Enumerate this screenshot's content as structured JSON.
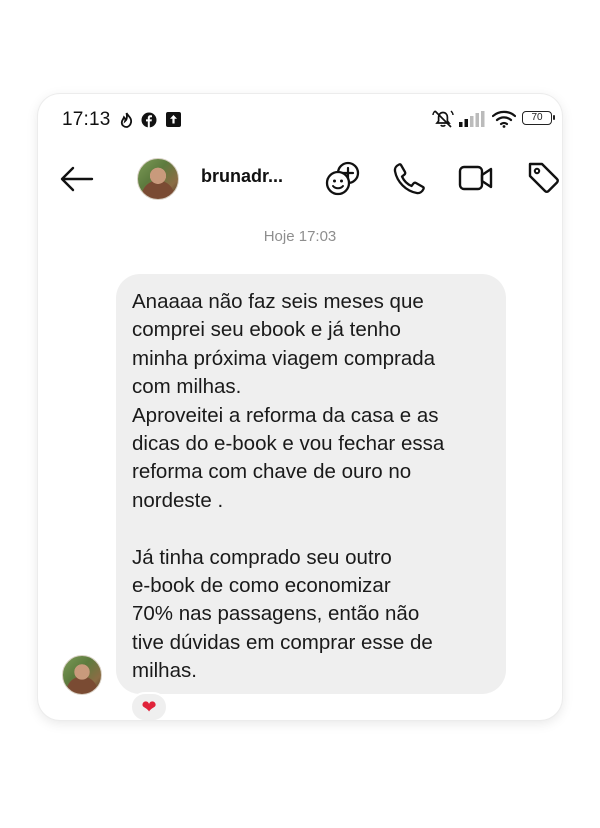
{
  "status_bar": {
    "time": "17:13",
    "battery": "70",
    "icons": [
      "flame-icon",
      "facebook-icon",
      "upload-icon",
      "mute-icon",
      "signal-icon",
      "wifi-icon",
      "battery-icon"
    ]
  },
  "header": {
    "username": "brunadr...",
    "icons": [
      "back-arrow-icon",
      "avatar",
      "effects-icon",
      "phone-icon",
      "video-icon",
      "tag-icon"
    ]
  },
  "conversation": {
    "timestamp": "Hoje 17:03",
    "message": "Anaaaa não faz seis meses que\ncomprei seu ebook e já tenho\nminha próxima viagem comprada\ncom milhas.\nAproveitei a reforma da casa e as\ndicas do e-book e vou fechar essa\nreforma com chave de ouro no\nnordeste .\n\nJá tinha comprado seu outro\ne-book de como economizar\n70% nas passagens, então não\ntive dúvidas em comprar esse de\nmilhas.",
    "reaction": "❤"
  },
  "colors": {
    "bubble": "#efefef",
    "timestamp": "#8e8e8e",
    "reaction_heart": "#e0233a"
  }
}
